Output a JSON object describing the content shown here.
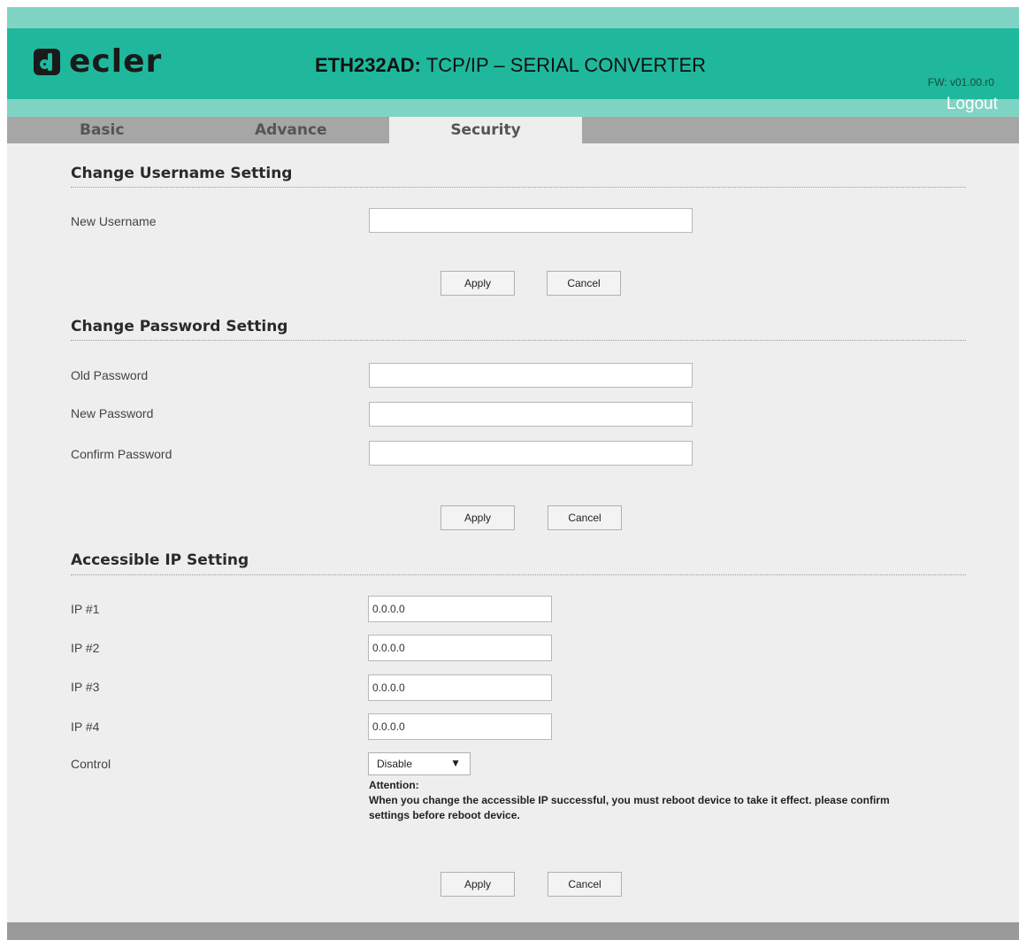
{
  "header": {
    "brand": "ecler",
    "model": "ETH232AD:",
    "product": "TCP/IP – SERIAL CONVERTER",
    "firmware": "FW: v01.00.r0",
    "logout": "Logout"
  },
  "tabs": [
    {
      "label": "Basic",
      "active": false
    },
    {
      "label": "Advance",
      "active": false
    },
    {
      "label": "Security",
      "active": true
    }
  ],
  "username_section": {
    "title": "Change Username Setting",
    "new_username_label": "New Username",
    "new_username_value": "",
    "apply": "Apply",
    "cancel": "Cancel"
  },
  "password_section": {
    "title": "Change Password Setting",
    "old_password_label": "Old Password",
    "new_password_label": "New Password",
    "confirm_password_label": "Confirm Password",
    "apply": "Apply",
    "cancel": "Cancel"
  },
  "ip_section": {
    "title": "Accessible IP Setting",
    "ips": [
      {
        "label": "IP #1",
        "value": "0.0.0.0"
      },
      {
        "label": "IP #2",
        "value": "0.0.0.0"
      },
      {
        "label": "IP #3",
        "value": "0.0.0.0"
      },
      {
        "label": "IP #4",
        "value": "0.0.0.0"
      }
    ],
    "control_label": "Control",
    "control_value": "Disable",
    "attention_title": "Attention:",
    "attention_text": "When you change the accessible IP successful, you must reboot device to take it effect. please confirm settings before reboot device.",
    "apply": "Apply",
    "cancel": "Cancel"
  },
  "colors": {
    "header_teal": "#1fb89c",
    "strip_teal": "#80d4c4",
    "tab_bar": "#a6a6a6",
    "content_bg": "#eeeeee"
  }
}
